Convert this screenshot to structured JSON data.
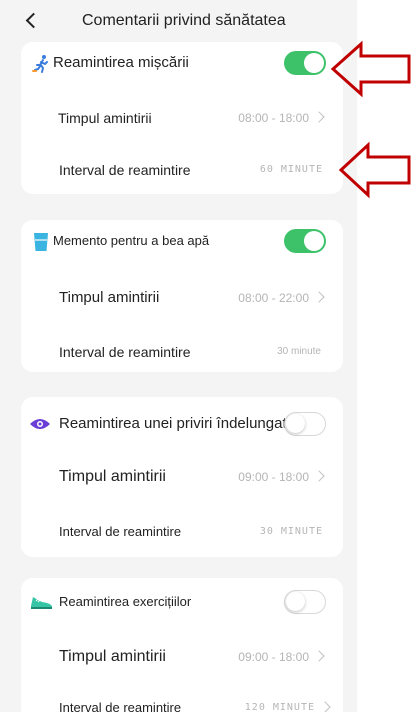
{
  "header": {
    "title": "Comentarii privind sănătatea"
  },
  "cards": [
    {
      "title": "Reamintirea mișcării",
      "icon": "walking-person-icon",
      "toggle": "on",
      "time_label": "Timpul amintirii",
      "time_value": "08:00 - 18:00",
      "interval_label": "Interval de reamintire",
      "interval_value": "60 MINUTE"
    },
    {
      "title": "Memento pentru a bea apă",
      "icon": "water-cup-icon",
      "toggle": "on",
      "time_label": "Timpul amintirii",
      "time_value": "08:00 - 22:00",
      "interval_label": "Interval de reamintire",
      "interval_value": "30 minute"
    },
    {
      "title": "Reamintirea unei priviri îndelungate",
      "icon": "eye-icon",
      "toggle": "off",
      "time_label": "Timpul amintirii",
      "time_value": "09:00 - 18:00",
      "interval_label": "Interval de reamintire",
      "interval_value": "30 MINUTE"
    },
    {
      "title": "Reamintirea exercițiilor",
      "icon": "sneaker-icon",
      "toggle": "off",
      "time_label": "Timpul amintirii",
      "time_value": "09:00 - 18:00",
      "interval_label": "Interval de reamintire",
      "interval_value": "120 MINUTE"
    }
  ],
  "colors": {
    "toggle_on": "#3dc26a",
    "annotation_arrow": "#c00000",
    "background": "#f4f4f4"
  }
}
